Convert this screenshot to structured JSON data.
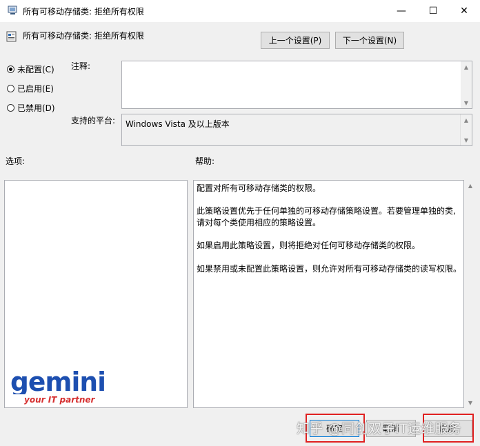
{
  "window": {
    "title": "所有可移动存储类: 拒绝所有权限",
    "minimize_glyph": "—",
    "maximize_glyph": "☐",
    "close_glyph": "✕"
  },
  "header": {
    "policy_name": "所有可移动存储类: 拒绝所有权限",
    "prev_button": "上一个设置(P)",
    "next_button": "下一个设置(N)"
  },
  "state": {
    "options": [
      {
        "label": "未配置(C)",
        "selected": true
      },
      {
        "label": "已启用(E)",
        "selected": false
      },
      {
        "label": "已禁用(D)",
        "selected": false
      }
    ]
  },
  "comment": {
    "label": "注释:",
    "value": ""
  },
  "platform": {
    "label": "支持的平台:",
    "value": "Windows Vista 及以上版本"
  },
  "options_panel": {
    "label": "选项:"
  },
  "help_panel": {
    "label": "帮助:",
    "lines": [
      "配置对所有可移动存储类的权限。",
      "此策略设置优先于任何单独的可移动存储策略设置。若要管理单独的类,",
      "请对每个类使用相应的策略设置。",
      "如果启用此策略设置，则将拒绝对任何可移动存储类的权限。",
      "如果禁用或未配置此策略设置，则允许对所有可移动存储类的读写权限。"
    ]
  },
  "footer": {
    "ok_button": "确定",
    "cancel_button": "取消",
    "apply_button": "应用"
  },
  "logo": {
    "brand": "gemini",
    "tagline": "your IT partner",
    "color": "#1d4fb0",
    "tagline_color": "#d63030"
  },
  "watermark": {
    "text": "知乎 @同创双子IT运维服务"
  }
}
